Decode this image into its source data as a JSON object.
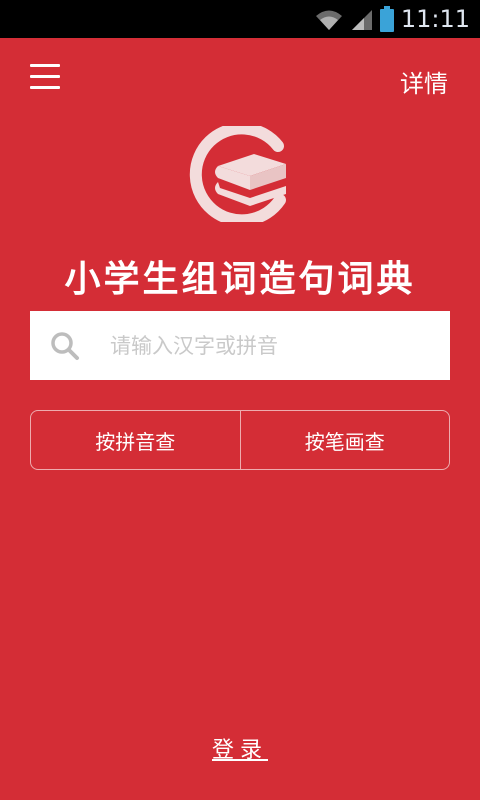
{
  "status_bar": {
    "time": "11:11",
    "icons": [
      "wifi-icon",
      "signal-icon",
      "battery-icon"
    ]
  },
  "header": {
    "menu_icon": "menu-icon",
    "details_label": "详情"
  },
  "app": {
    "title": "小学生组词造句词典",
    "logo_icon": "book-logo-icon"
  },
  "search": {
    "placeholder": "请输入汉字或拼音",
    "value": "",
    "icon": "search-icon"
  },
  "modes": [
    {
      "label": "按拼音查"
    },
    {
      "label": "按笔画查"
    }
  ],
  "footer": {
    "login_label": "登录"
  },
  "colors": {
    "background": "#d42d36",
    "statusbar": "#000000",
    "text": "#ffffff",
    "search_bg": "#ffffff",
    "placeholder": "#c9c9c9"
  }
}
